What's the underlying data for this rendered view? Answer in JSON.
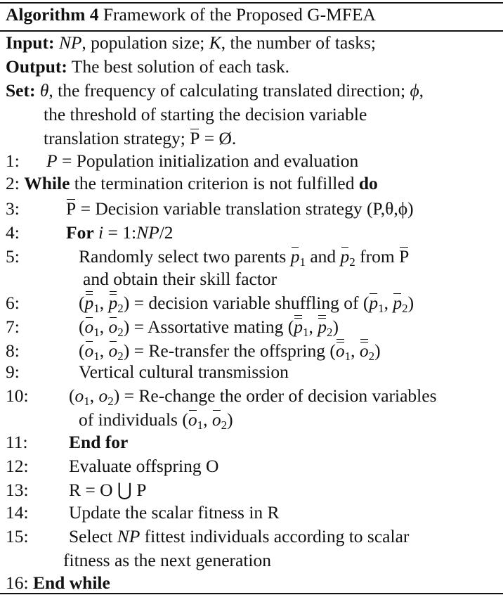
{
  "header": {
    "label": "Algorithm 4",
    "title": "Framework of the Proposed G-MFEA"
  },
  "input": {
    "label": "Input:",
    "np": "NP",
    "text1": ", population size; ",
    "k": "K",
    "text2": ", the number of tasks;"
  },
  "output": {
    "label": "Output:",
    "text": "The best solution of each task."
  },
  "set": {
    "label": "Set:",
    "theta": "θ",
    "text1": ", the frequency of calculating translated direction; ",
    "phi": "ϕ",
    "text2": ",",
    "line2": "the threshold of starting the decision variable",
    "line3a": "translation strategy; ",
    "pbar": "P",
    "line3b": " = Ø."
  },
  "steps": {
    "s1": {
      "num": "1:",
      "var": "P",
      "text": " = Population initialization and evaluation"
    },
    "s2": {
      "num": "2:",
      "kw": "While",
      "text": " the termination criterion is not fulfilled ",
      "kw2": "do"
    },
    "s3": {
      "num": "3:",
      "pbar": "P",
      "text": " = Decision variable translation strategy (P,θ,ϕ)"
    },
    "s4": {
      "num": "4:",
      "kw": "For",
      "var": "i",
      "text": " = 1:",
      "np": "NP",
      "tail": "/2"
    },
    "s5": {
      "num": "5:",
      "text1": "Randomly select two parents ",
      "p": "p",
      "sub1": "1",
      "and": " and ",
      "sub2": "2",
      "from": " from ",
      "pbar": "P",
      "line2": "and obtain their skill factor"
    },
    "s6": {
      "num": "6:",
      "text": " = decision variable shuffling of "
    },
    "s7": {
      "num": "7:",
      "text": " = Assortative mating "
    },
    "s8": {
      "num": "8:",
      "text": " = Re-transfer the offspring "
    },
    "s9": {
      "num": "9:",
      "text": "Vertical cultural transmission"
    },
    "s10": {
      "num": "10:",
      "text": " = Re-change the order of decision variables",
      "line2": "of individuals "
    },
    "s11": {
      "num": "11:",
      "kw": "End for"
    },
    "s12": {
      "num": "12:",
      "text": "Evaluate offspring O"
    },
    "s13": {
      "num": "13:",
      "text": "R = O ⋃ P"
    },
    "s14": {
      "num": "14:",
      "text": "Update the scalar fitness in R"
    },
    "s15": {
      "num": "15:",
      "text1": "Select ",
      "np": "NP",
      "text2": " fittest individuals according to scalar",
      "line2": "fitness as the next generation"
    },
    "s16": {
      "num": "16:",
      "kw": "End while"
    }
  }
}
